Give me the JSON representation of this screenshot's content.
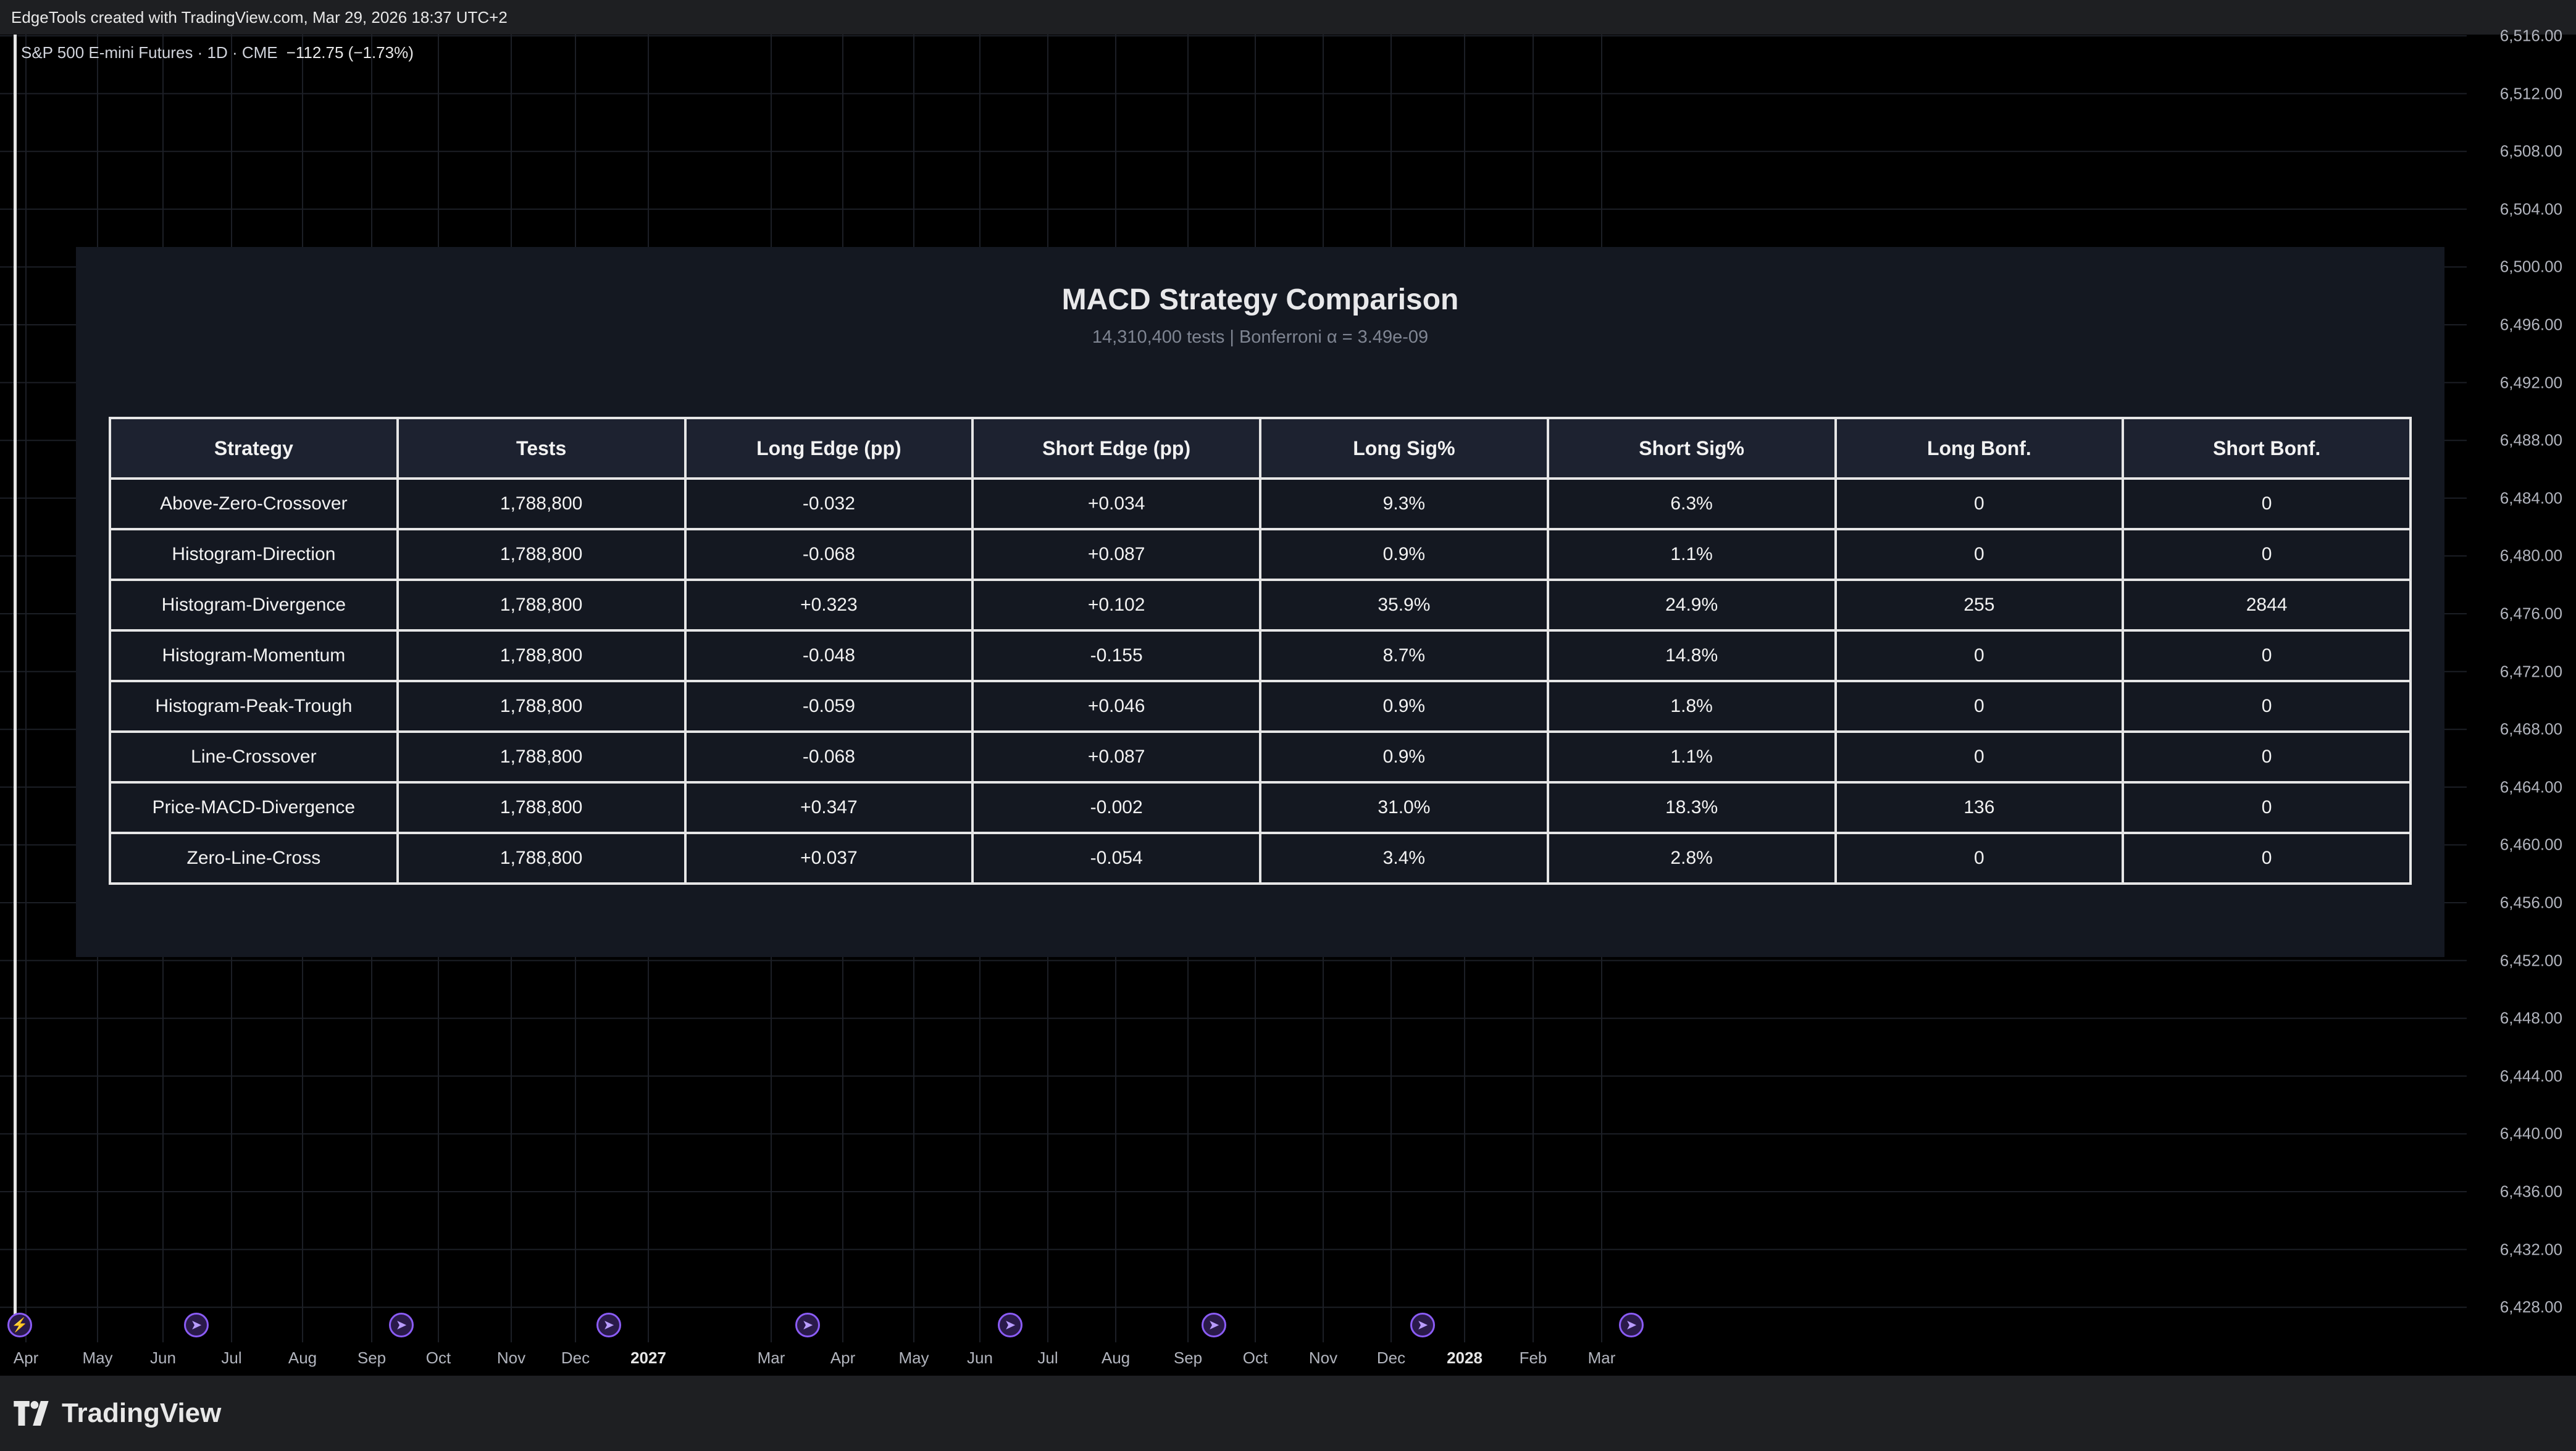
{
  "header": {
    "caption": "EdgeTools created with TradingView.com, Mar 29, 2026 18:37 UTC+2"
  },
  "chart": {
    "symbol": "S&P 500 E-mini Futures · 1D · CME",
    "change": "−112.75 (−1.73%)",
    "price_labels": [
      "6,516.00",
      "6,512.00",
      "6,508.00",
      "6,504.00",
      "6,500.00",
      "6,496.00",
      "6,492.00",
      "6,488.00",
      "6,484.00",
      "6,480.00",
      "6,476.00",
      "6,472.00",
      "6,468.00",
      "6,464.00",
      "6,460.00",
      "6,456.00",
      "6,452.00",
      "6,448.00",
      "6,444.00",
      "6,440.00",
      "6,436.00",
      "6,432.00",
      "6,428.00"
    ],
    "time_labels": [
      {
        "t": "Apr",
        "major": false
      },
      {
        "t": "May",
        "major": false
      },
      {
        "t": "Jun",
        "major": false
      },
      {
        "t": "Jul",
        "major": false
      },
      {
        "t": "Aug",
        "major": false
      },
      {
        "t": "Sep",
        "major": false
      },
      {
        "t": "Oct",
        "major": false
      },
      {
        "t": "Nov",
        "major": false
      },
      {
        "t": "Dec",
        "major": false
      },
      {
        "t": "2027",
        "major": true
      },
      {
        "t": "Mar",
        "major": false
      },
      {
        "t": "Apr",
        "major": false
      },
      {
        "t": "May",
        "major": false
      },
      {
        "t": "Jun",
        "major": false
      },
      {
        "t": "Jul",
        "major": false
      },
      {
        "t": "Aug",
        "major": false
      },
      {
        "t": "Sep",
        "major": false
      },
      {
        "t": "Oct",
        "major": false
      },
      {
        "t": "Nov",
        "major": false
      },
      {
        "t": "Dec",
        "major": false
      },
      {
        "t": "2028",
        "major": true
      },
      {
        "t": "Feb",
        "major": false
      },
      {
        "t": "Mar",
        "major": false
      }
    ],
    "event_marker_count": 9,
    "marker_color": "#8b5cf6"
  },
  "panel": {
    "title": "MACD Strategy Comparison",
    "subtitle": "14,310,400 tests | Bonferroni α = 3.49e-09",
    "columns": [
      "Strategy",
      "Tests",
      "Long Edge (pp)",
      "Short Edge (pp)",
      "Long Sig%",
      "Short Sig%",
      "Long Bonf.",
      "Short Bonf."
    ],
    "rows": [
      [
        "Above-Zero-Crossover",
        "1,788,800",
        "-0.032",
        "+0.034",
        "9.3%",
        "6.3%",
        "0",
        "0"
      ],
      [
        "Histogram-Direction",
        "1,788,800",
        "-0.068",
        "+0.087",
        "0.9%",
        "1.1%",
        "0",
        "0"
      ],
      [
        "Histogram-Divergence",
        "1,788,800",
        "+0.323",
        "+0.102",
        "35.9%",
        "24.9%",
        "255",
        "2844"
      ],
      [
        "Histogram-Momentum",
        "1,788,800",
        "-0.048",
        "-0.155",
        "8.7%",
        "14.8%",
        "0",
        "0"
      ],
      [
        "Histogram-Peak-Trough",
        "1,788,800",
        "-0.059",
        "+0.046",
        "0.9%",
        "1.8%",
        "0",
        "0"
      ],
      [
        "Line-Crossover",
        "1,788,800",
        "-0.068",
        "+0.087",
        "0.9%",
        "1.1%",
        "0",
        "0"
      ],
      [
        "Price-MACD-Divergence",
        "1,788,800",
        "+0.347",
        "-0.002",
        "31.0%",
        "18.3%",
        "136",
        "0"
      ],
      [
        "Zero-Line-Cross",
        "1,788,800",
        "+0.037",
        "-0.054",
        "3.4%",
        "2.8%",
        "0",
        "0"
      ]
    ]
  },
  "footer": {
    "logo_text": "TradingView"
  }
}
